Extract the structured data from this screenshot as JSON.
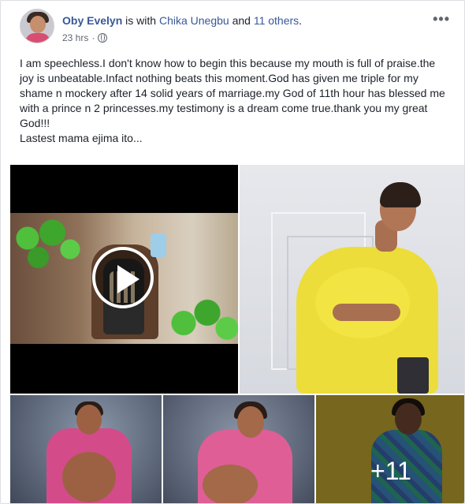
{
  "post": {
    "author": "Oby Evelyn",
    "with_text": " is with ",
    "tagged_person": "Chika Unegbu",
    "and_text": " and ",
    "others": "11 others",
    "period": ".",
    "timestamp": "23 hrs",
    "separator": "·",
    "audience_icon": "globe-icon",
    "more_label": "•••",
    "text": "I am speechless.I don't know how to begin this because my mouth is full of praise.the joy is unbeatable.Infact nothing beats this moment.God has given me triple for my shame n mockery after 14 solid years of marriage.my God of 11th hour has blessed me with a prince n 2 princesses.my testimony is a dream come true.thank you my great God!!!\nLastest mama ejima ito..."
  },
  "media": {
    "play_icon": "play-icon",
    "more_photos": "+11"
  }
}
